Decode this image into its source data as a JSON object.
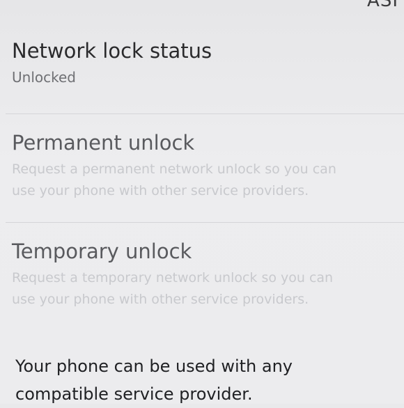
{
  "status_bar": {
    "fragment": "ASI"
  },
  "network_lock_status": {
    "title": "Network lock status",
    "value": "Unlocked"
  },
  "permanent_unlock": {
    "title": "Permanent unlock",
    "description_line1": "Request a permanent network unlock so you can",
    "description_line2": "use your phone with other service providers."
  },
  "temporary_unlock": {
    "title": "Temporary unlock",
    "description_line1": "Request a temporary network unlock so you can",
    "description_line2": "use your phone with other service providers."
  },
  "info": {
    "text": "Your phone can be used with any compatible service provider."
  }
}
